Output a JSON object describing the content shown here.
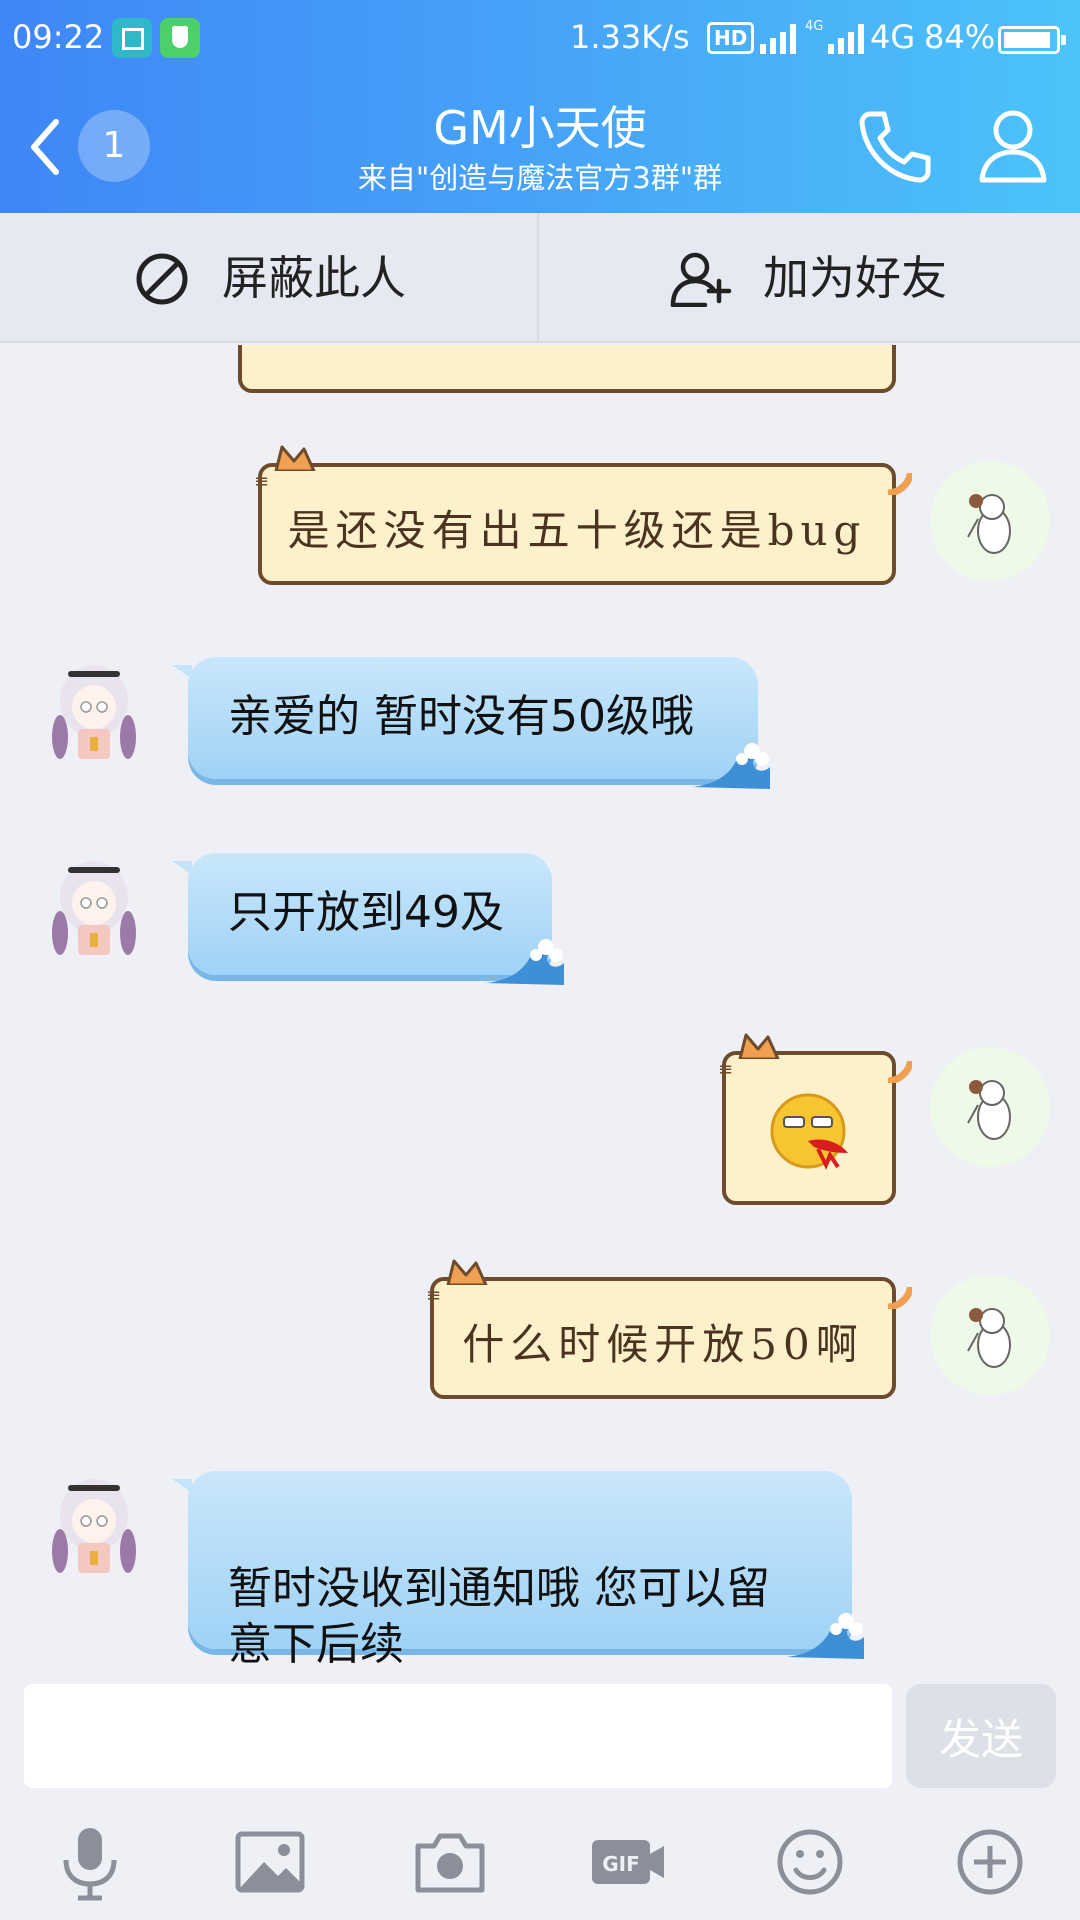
{
  "status_bar": {
    "time": "09:22",
    "net_speed": "1.33K/s",
    "hd_label": "HD",
    "small_4g": "4G",
    "network": "4G",
    "battery": "84%"
  },
  "header": {
    "unread_count": "1",
    "title": "GM小天使",
    "subtitle": "来自\"创造与魔法官方3群\"群"
  },
  "actions": {
    "block_label": "屏蔽此人",
    "add_friend_label": "加为好友"
  },
  "messages": [
    {
      "from": "me",
      "style": "cat",
      "text": "是还没有出五十级还是bug"
    },
    {
      "from": "them",
      "style": "blue",
      "text": "亲爱的 暂时没有50级哦"
    },
    {
      "from": "them",
      "style": "blue",
      "text": "只开放到49及"
    },
    {
      "from": "me",
      "style": "cat-emoji",
      "text": "",
      "icon": "nosebleed-emoji-icon"
    },
    {
      "from": "me",
      "style": "cat",
      "text": "什么时候开放50啊"
    },
    {
      "from": "them",
      "style": "blue",
      "text": "暂时没收到通知哦 您可以留\n意下后续"
    }
  ],
  "composer": {
    "value": "",
    "send_label": "发送"
  },
  "toolbar": [
    "mic-icon",
    "image-icon",
    "camera-icon",
    "gif-icon",
    "emoji-icon",
    "plus-icon"
  ],
  "colors": {
    "header_start": "#3f86f6",
    "header_end": "#4cc3f9",
    "bubble_blue": "#9fd2f6",
    "bubble_cat": "#fdf1cc"
  }
}
